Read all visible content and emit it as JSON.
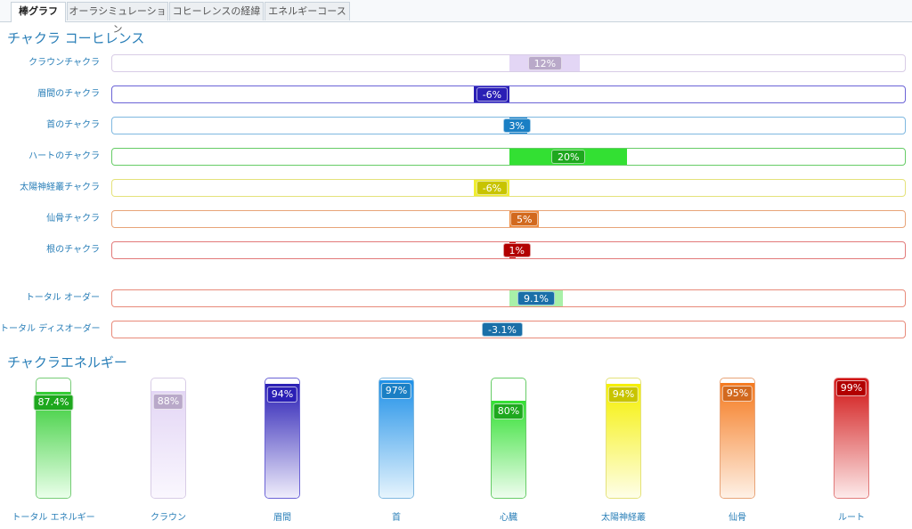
{
  "tabs": [
    {
      "label": "棒グラフ",
      "active": true
    },
    {
      "label": "オーラシミュレーション",
      "active": false
    },
    {
      "label": "コヒーレンスの経緯",
      "active": false
    },
    {
      "label": "エネルギーコース",
      "active": false
    }
  ],
  "coherence": {
    "title": "チャクラ コーヒレンス",
    "rows": [
      {
        "label": "クラウンチャクラ",
        "value": 12,
        "text": "12%",
        "color": "#b9a9c9",
        "fill": "#e3d6f5",
        "border": "#d8cce6"
      },
      {
        "label": "眉間のチャクラ",
        "value": -6,
        "text": "-6%",
        "color": "#2a1fb5",
        "fill": "#2a1fb5",
        "border": "#6b63d6"
      },
      {
        "label": "首のチャクラ",
        "value": 3,
        "text": "3%",
        "color": "#1a7fc4",
        "fill": "#1a7fc4",
        "border": "#7fb8e0"
      },
      {
        "label": "ハートのチャクラ",
        "value": 20,
        "text": "20%",
        "color": "#1ea81e",
        "fill": "#33e033",
        "border": "#66cc66"
      },
      {
        "label": "太陽神経叢チャクラ",
        "value": -6,
        "text": "-6%",
        "color": "#c8c400",
        "fill": "#f0ee30",
        "border": "#e4e27a"
      },
      {
        "label": "仙骨チャクラ",
        "value": 5,
        "text": "5%",
        "color": "#d2691e",
        "fill": "#f08a3a",
        "border": "#e8a478"
      },
      {
        "label": "根のチャクラ",
        "value": 1,
        "text": "1%",
        "color": "#b20000",
        "fill": "#d01010",
        "border": "#e27a7a"
      }
    ],
    "totals": [
      {
        "label": "トータル オーダー",
        "value": 9.1,
        "text": "9.1%",
        "color": "#1a6fa8",
        "fill": "#a8f0a8",
        "border": "#e88a7a"
      },
      {
        "label": "トータル ディスオーダー",
        "value": -3.1,
        "text": "-3.1%",
        "color": "#1a6fa8",
        "fill": "#f8f8f8",
        "border": "#e88a7a"
      }
    ]
  },
  "energy": {
    "title": "チャクラエネルギー",
    "bars": [
      {
        "label": "トータル エネルギー",
        "value": 87.4,
        "text": "87.4%",
        "top": "#33cc33",
        "bottom": "#eaffea",
        "badge": "#1ea81e",
        "border": "#77cc77"
      },
      {
        "label": "クラウン",
        "value": 88,
        "text": "88%",
        "top": "#e3d6f5",
        "bottom": "#faf7fe",
        "badge": "#b9a9c9",
        "border": "#d8cce6"
      },
      {
        "label": "眉間",
        "value": 94,
        "text": "94%",
        "top": "#2a1fb5",
        "bottom": "#efedfb",
        "badge": "#2a1fb5",
        "border": "#6b63d6"
      },
      {
        "label": "首",
        "value": 97,
        "text": "97%",
        "top": "#1e90e8",
        "bottom": "#e6f4fd",
        "badge": "#1a7fc4",
        "border": "#7fb8e0"
      },
      {
        "label": "心臓",
        "value": 80,
        "text": "80%",
        "top": "#33e033",
        "bottom": "#effdef",
        "badge": "#1ea81e",
        "border": "#66cc66"
      },
      {
        "label": "太陽神経叢",
        "value": 94,
        "text": "94%",
        "top": "#f5f000",
        "bottom": "#fefee8",
        "badge": "#c8c400",
        "border": "#e4e27a"
      },
      {
        "label": "仙骨",
        "value": 95,
        "text": "95%",
        "top": "#f57a1f",
        "bottom": "#fef1e6",
        "badge": "#d2691e",
        "border": "#e8a478"
      },
      {
        "label": "ルート",
        "value": 99,
        "text": "99%",
        "top": "#d01010",
        "bottom": "#fdeaea",
        "badge": "#b20000",
        "border": "#e27a7a"
      }
    ]
  }
}
